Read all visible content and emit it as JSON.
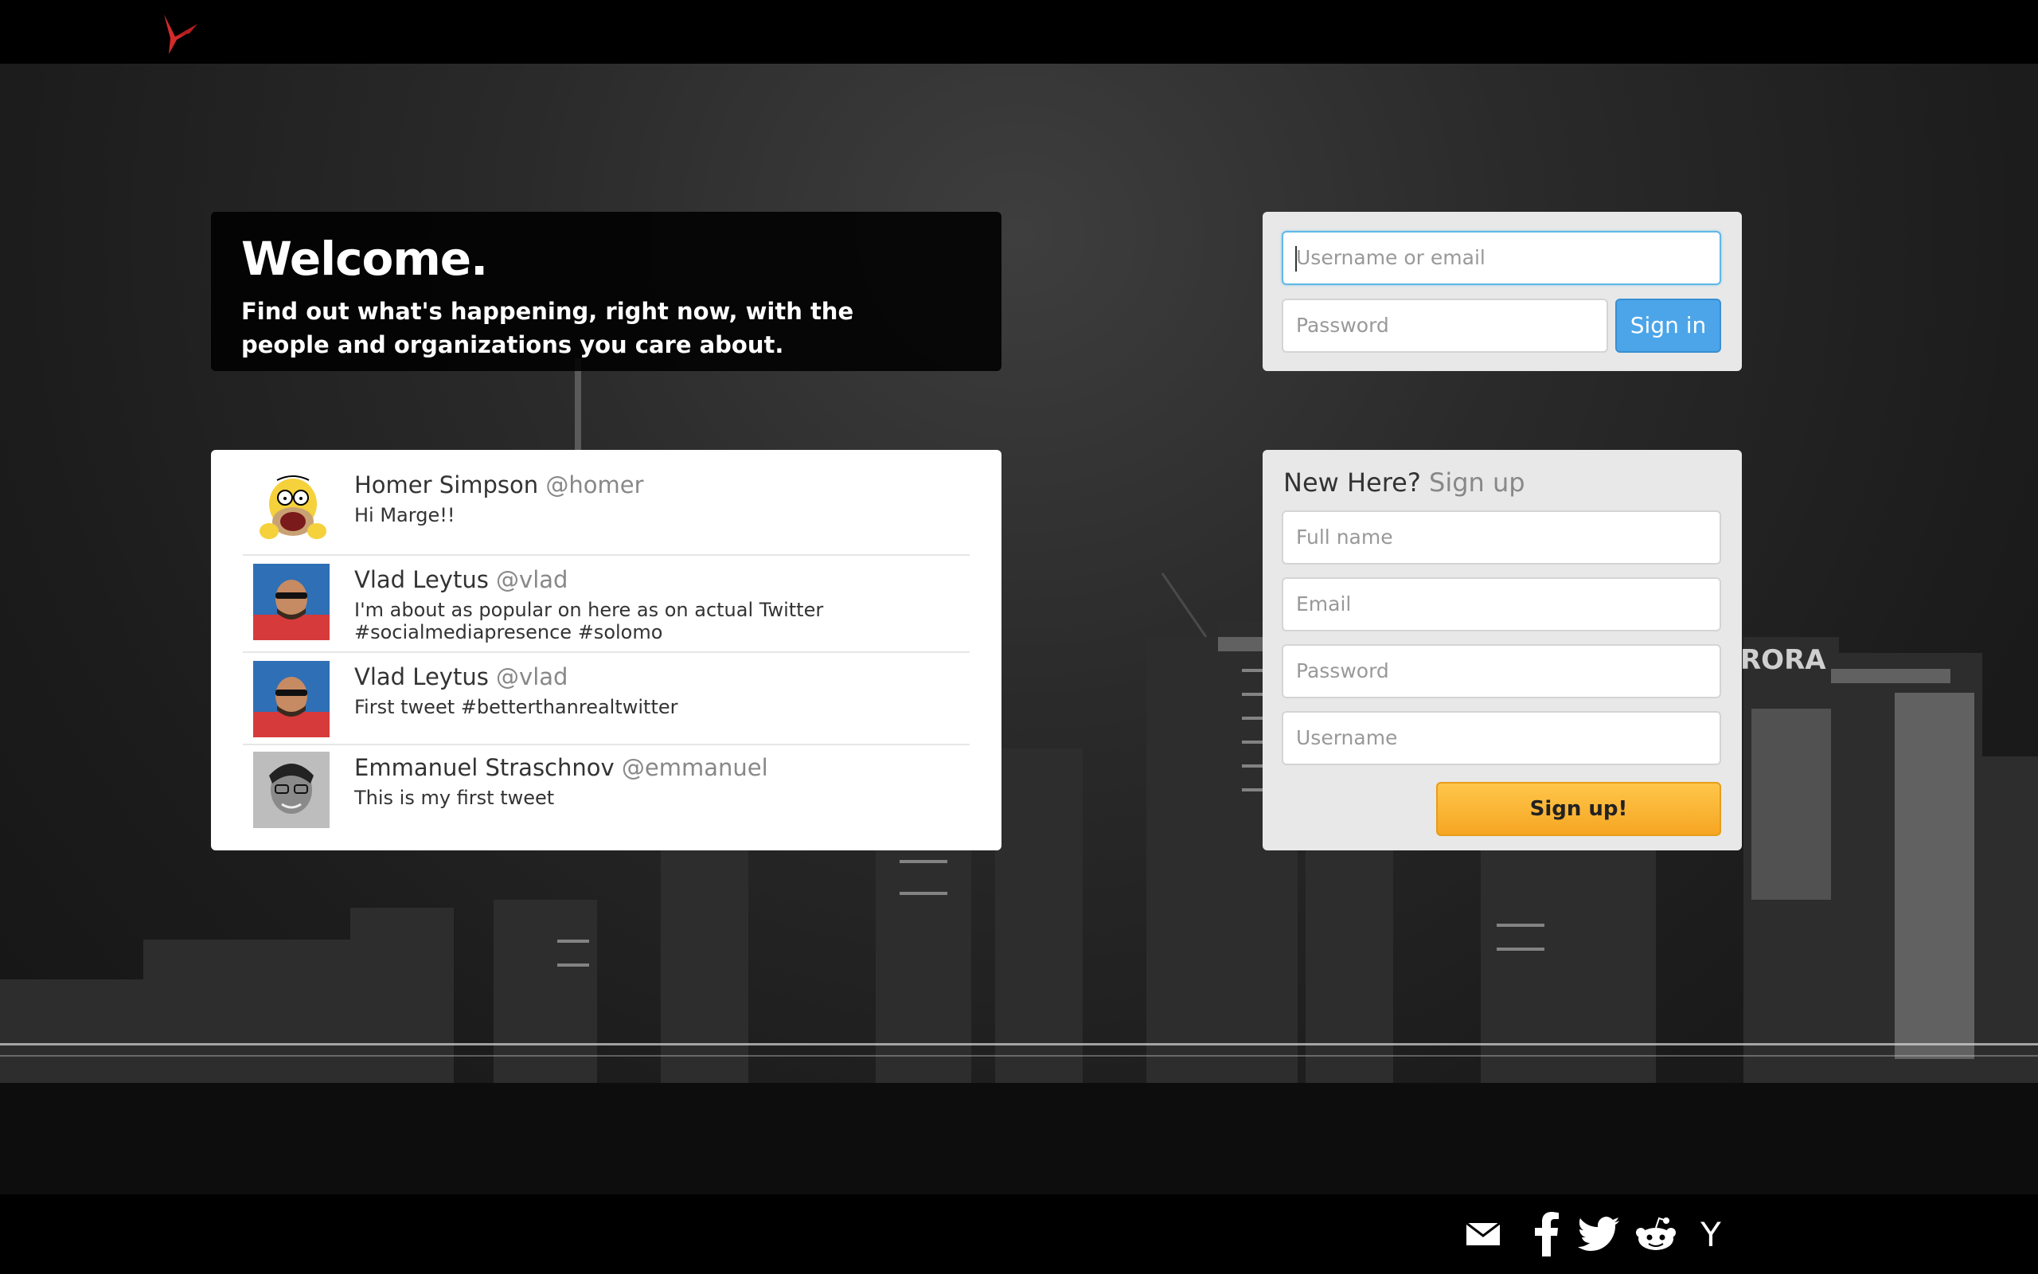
{
  "brand": {
    "logo_icon": "hummingbird-icon",
    "accent": "#d42a2a"
  },
  "welcome": {
    "title": "Welcome.",
    "tagline": "Find out what's happening, right now, with the people and organizations you care about."
  },
  "login": {
    "username_placeholder": "Username or email",
    "password_placeholder": "Password",
    "signin_label": "Sign in",
    "signin_color": "#4ba5e8"
  },
  "tweets": [
    {
      "name": "Homer Simpson",
      "handle": "@homer",
      "text": "Hi Marge!!",
      "avatar": "homer-simpson-avatar"
    },
    {
      "name": "Vlad Leytus",
      "handle": "@vlad",
      "text": "I'm about as popular on here as on actual Twitter #socialmediapresence #solomo",
      "avatar": "vlad-avatar"
    },
    {
      "name": "Vlad Leytus",
      "handle": "@vlad",
      "text": "First tweet #betterthanrealtwitter",
      "avatar": "vlad-avatar"
    },
    {
      "name": "Emmanuel Straschnov",
      "handle": "@emmanuel",
      "text": "This is my first tweet",
      "avatar": "emmanuel-avatar"
    }
  ],
  "signup": {
    "title_main": "New Here?",
    "title_sub": "Sign up",
    "fullname_placeholder": "Full name",
    "email_placeholder": "Email",
    "password_placeholder": "Password",
    "username_placeholder": "Username",
    "button_label": "Sign up!",
    "button_color": "#f6a623"
  },
  "background": {
    "sign_text": "RORA"
  },
  "footer": {
    "icons": [
      "mail-icon",
      "facebook-icon",
      "twitter-icon",
      "reddit-icon",
      "hacker-news-icon"
    ],
    "hacker_news_glyph": "Y"
  }
}
